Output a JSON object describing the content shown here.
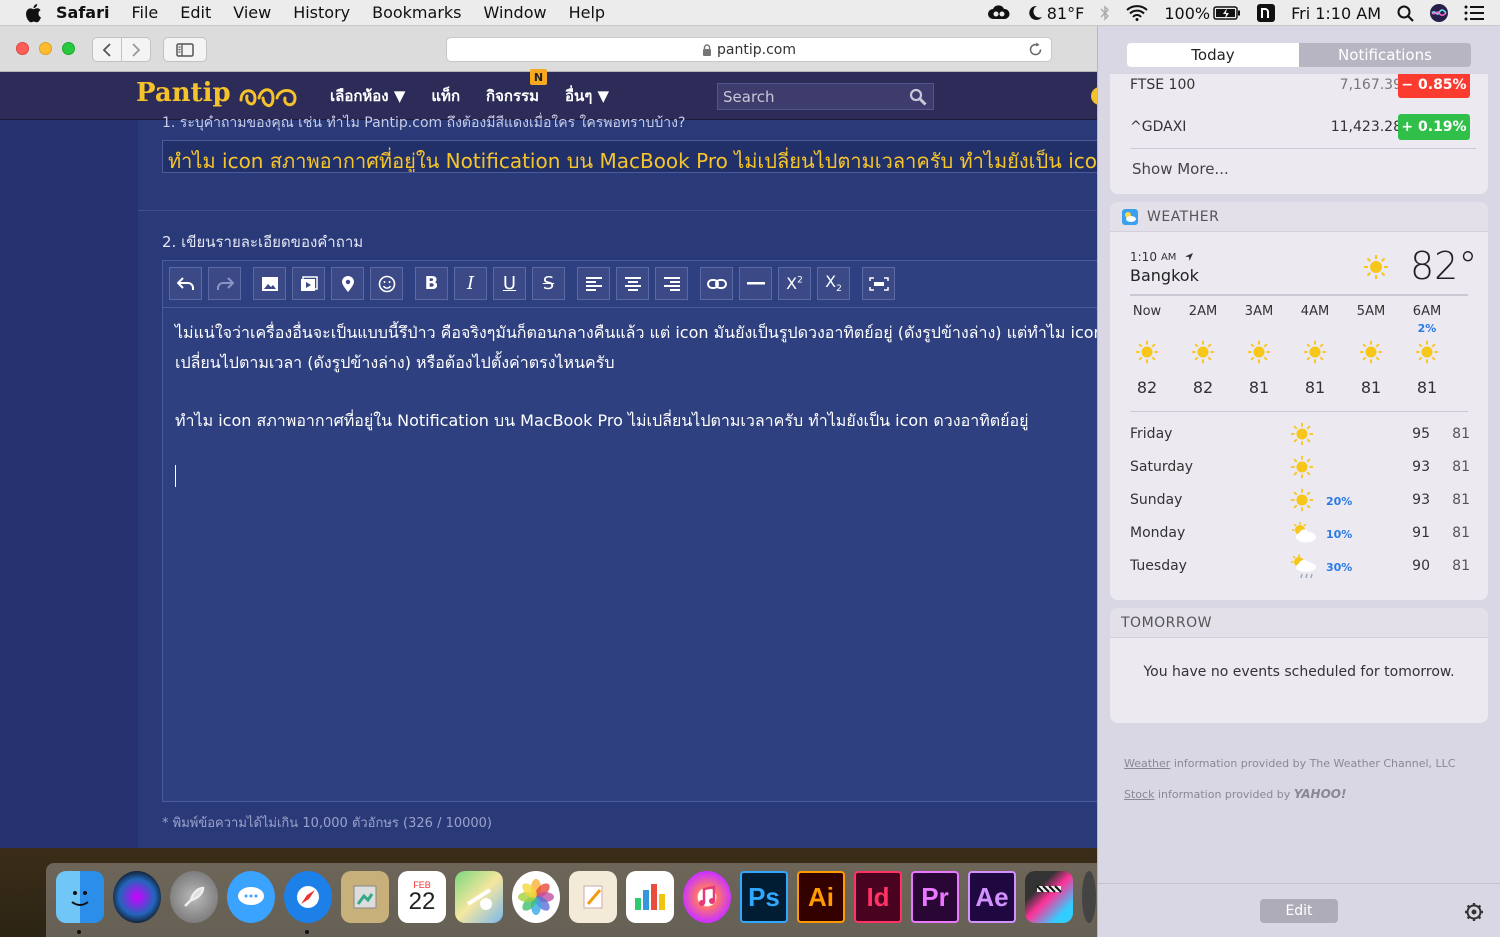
{
  "menubar": {
    "app": "Safari",
    "items": [
      "File",
      "Edit",
      "View",
      "History",
      "Bookmarks",
      "Window",
      "Help"
    ],
    "weather_temp": "81°F",
    "battery": "100%",
    "clock": "Fri 1:10 AM"
  },
  "browser": {
    "url": "pantip.com"
  },
  "pantip": {
    "logo": "Pantip",
    "nav": [
      "เลือกห้อง ▼",
      "แท็ก",
      "กิจกรรม",
      "อื่นๆ ▼"
    ],
    "activity_badge": "N",
    "search_placeholder": "Search",
    "q1_label": "1. ระบุคำถามของคุณ เช่น ทำไม Pantip.com ถึงต้องมีสีแดงเมื่อใคร ใครพอทราบบ้าง?",
    "title_value": "ทำไม icon สภาพอากาศที่อยู่ใน Notification บน MacBook Pro ไม่เปลี่ยนไปตามเวลาครับ ทำไมยังเป็น icon ดวงอาทิตย์อยู่",
    "q2_label": "2. เขียนรายละเอียดของคำถาม",
    "editor_line1": "ไม่แน่ใจว่าเครื่องอื่นจะเป็นแบบนี้รึป่าว คือจริงๆมันก็ตอนกลางคืนแล้ว แต่ icon มันยังเป็นรูปดวงอาทิตย์อยู่ (ดังรูปข้างล่าง) แต่ทำไม icon ไม่",
    "editor_line2": "เปลี่ยนไปตามเวลา (ดังรูปข้างล่าง) หรือต้องไปตั้งค่าตรงไหนครับ",
    "editor_line3": "ทำไม icon สภาพอากาศที่อยู่ใน Notification บน MacBook Pro ไม่เปลี่ยนไปตามเวลาครับ ทำไมยังเป็น icon ดวงอาทิตย์อยู่",
    "char_count": "* พิมพ์ข้อความได้ไม่เกิน 10,000 ตัวอักษร (326 / 10000)"
  },
  "notification_center": {
    "tabs": {
      "today": "Today",
      "notifications": "Notifications"
    },
    "stocks": [
      {
        "symbol": "FTSE 100",
        "price": "7,167.39",
        "change": "− 0.85%",
        "color": "#fb3b30"
      },
      {
        "symbol": "^GDAXI",
        "price": "11,423.28",
        "change": "+ 0.19%",
        "color": "#30c04a"
      }
    ],
    "show_more": "Show More...",
    "weather": {
      "header": "WEATHER",
      "time": "1:10",
      "ampm": "AM",
      "city": "Bangkok",
      "current_temp": "82°",
      "hourly": [
        {
          "label": "Now",
          "pct": "",
          "temp": "82"
        },
        {
          "label": "2AM",
          "pct": "",
          "temp": "82"
        },
        {
          "label": "3AM",
          "pct": "",
          "temp": "81"
        },
        {
          "label": "4AM",
          "pct": "",
          "temp": "81"
        },
        {
          "label": "5AM",
          "pct": "",
          "temp": "81"
        },
        {
          "label": "6AM",
          "pct": "2%",
          "temp": "81"
        }
      ],
      "daily": [
        {
          "day": "Friday",
          "icon": "sun-icon",
          "pct": "",
          "hi": "95",
          "lo": "81"
        },
        {
          "day": "Saturday",
          "icon": "sun-icon",
          "pct": "",
          "hi": "93",
          "lo": "81"
        },
        {
          "day": "Sunday",
          "icon": "sun-icon",
          "pct": "20%",
          "hi": "93",
          "lo": "81"
        },
        {
          "day": "Monday",
          "icon": "partly-cloudy-icon",
          "pct": "10%",
          "hi": "91",
          "lo": "81"
        },
        {
          "day": "Tuesday",
          "icon": "rain-sun-icon",
          "pct": "30%",
          "hi": "90",
          "lo": "81"
        }
      ]
    },
    "tomorrow": {
      "header": "TOMORROW",
      "message": "You have no events scheduled for tomorrow."
    },
    "credits": {
      "weather_link": "Weather",
      "weather_text": " information provided by The Weather Channel, LLC",
      "stock_link": "Stock",
      "stock_text": " information provided by ",
      "yahoo": "YAHOO!"
    },
    "edit_label": "Edit"
  },
  "dock": {
    "ps": "Ps",
    "ai": "Ai",
    "id": "Id",
    "pr": "Pr",
    "ae": "Ae",
    "calendar_month": "FEB",
    "calendar_day": "22"
  }
}
